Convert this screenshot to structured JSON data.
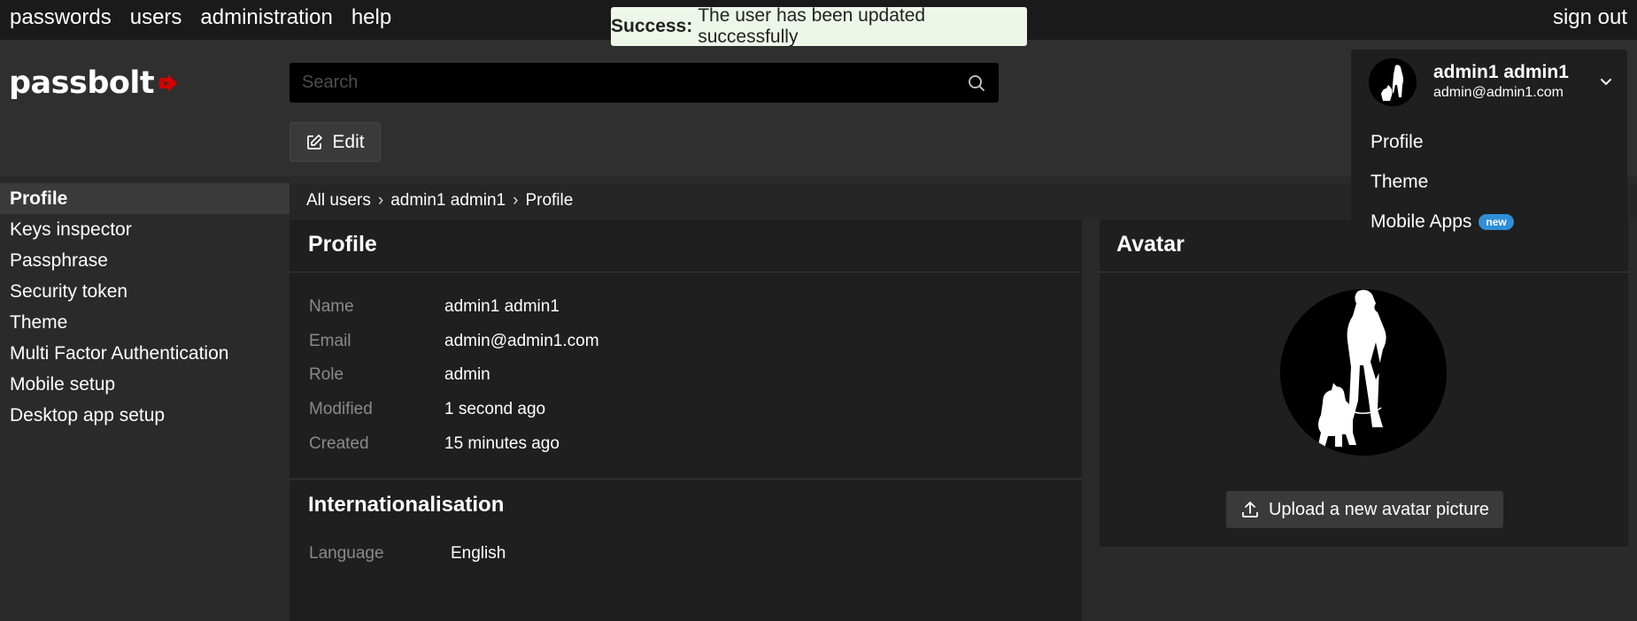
{
  "topnav": {
    "items": [
      {
        "label": "passwords"
      },
      {
        "label": "users"
      },
      {
        "label": "administration"
      },
      {
        "label": "help"
      }
    ],
    "signout": "sign out"
  },
  "toast": {
    "title": "Success:",
    "message": "The user has been updated successfully",
    "color": "#edf7e9"
  },
  "logo": {
    "text": "passbolt",
    "accent": "#d40101"
  },
  "search": {
    "placeholder": "Search",
    "value": ""
  },
  "toolbar": {
    "edit_label": "Edit"
  },
  "user": {
    "name": "admin1 admin1",
    "email": "admin@admin1.com",
    "menu": [
      {
        "label": "Profile"
      },
      {
        "label": "Theme"
      },
      {
        "label": "Mobile Apps",
        "badge": "new"
      }
    ]
  },
  "sidebar": {
    "items": [
      {
        "label": "Profile",
        "active": true
      },
      {
        "label": "Keys inspector"
      },
      {
        "label": "Passphrase"
      },
      {
        "label": "Security token"
      },
      {
        "label": "Theme"
      },
      {
        "label": "Multi Factor Authentication"
      },
      {
        "label": "Mobile setup"
      },
      {
        "label": "Desktop app setup"
      }
    ]
  },
  "breadcrumb": {
    "items": [
      "All users",
      "admin1 admin1",
      "Profile"
    ],
    "separator": "›"
  },
  "profile": {
    "title": "Profile",
    "fields": [
      {
        "label": "Name",
        "value": "admin1 admin1"
      },
      {
        "label": "Email",
        "value": "admin@admin1.com"
      },
      {
        "label": "Role",
        "value": "admin"
      },
      {
        "label": "Modified",
        "value": "1 second ago"
      },
      {
        "label": "Created",
        "value": "15 minutes ago"
      }
    ],
    "i18n_title": "Internationalisation",
    "language_label": "Language",
    "language_value": "English"
  },
  "avatar": {
    "title": "Avatar",
    "upload_label": "Upload a new avatar picture"
  }
}
